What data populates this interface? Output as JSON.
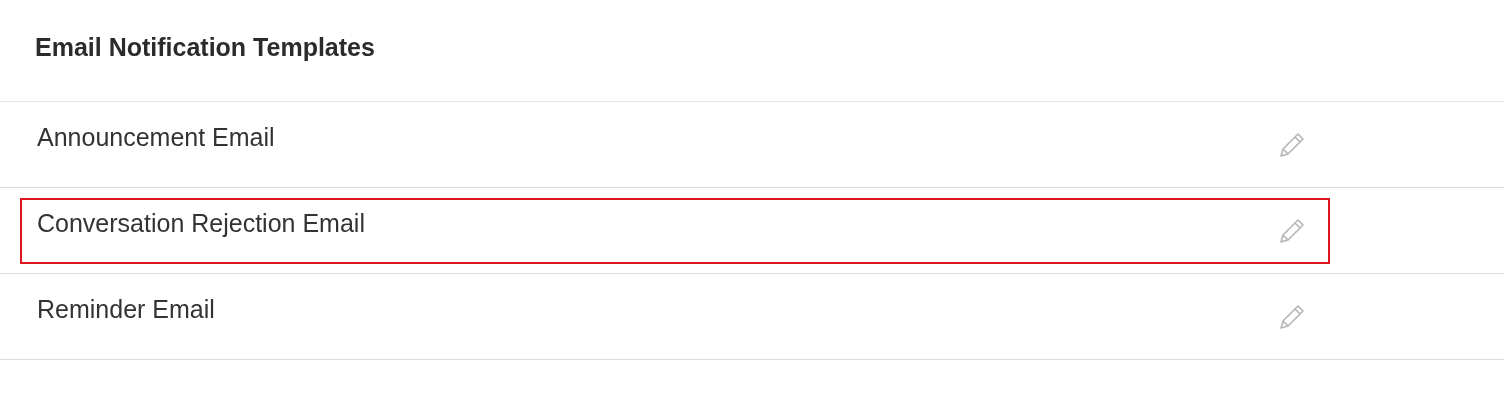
{
  "title": "Email Notification Templates",
  "templates": [
    {
      "name": "Announcement Email",
      "highlighted": false
    },
    {
      "name": "Conversation Rejection Email",
      "highlighted": true
    },
    {
      "name": "Reminder Email",
      "highlighted": false
    }
  ]
}
